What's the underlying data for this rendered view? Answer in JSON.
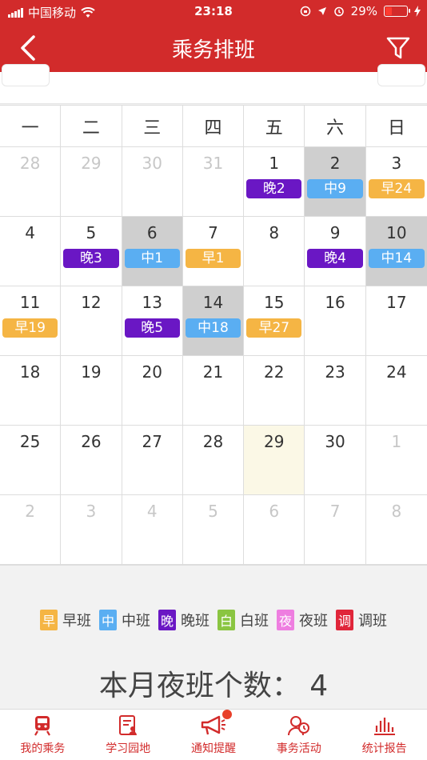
{
  "status_bar": {
    "carrier": "中国移动",
    "time": "23:18",
    "battery": "29%",
    "battery_level": 0.29
  },
  "header": {
    "title": "乘务排班"
  },
  "calendar": {
    "week_labels": [
      "一",
      "二",
      "三",
      "四",
      "五",
      "六",
      "日"
    ],
    "days": [
      {
        "num": "28",
        "other": true
      },
      {
        "num": "29",
        "other": true
      },
      {
        "num": "30",
        "other": true
      },
      {
        "num": "31",
        "other": true
      },
      {
        "num": "1",
        "badge": "晚2",
        "type": "night"
      },
      {
        "num": "2",
        "badge": "中9",
        "type": "mid",
        "gray": true
      },
      {
        "num": "3",
        "badge": "早24",
        "type": "early"
      },
      {
        "num": "4"
      },
      {
        "num": "5",
        "badge": "晚3",
        "type": "night"
      },
      {
        "num": "6",
        "badge": "中1",
        "type": "mid",
        "gray": true
      },
      {
        "num": "7",
        "badge": "早1",
        "type": "early"
      },
      {
        "num": "8"
      },
      {
        "num": "9",
        "badge": "晚4",
        "type": "night"
      },
      {
        "num": "10",
        "badge": "中14",
        "type": "mid",
        "gray": true
      },
      {
        "num": "11",
        "badge": "早19",
        "type": "early"
      },
      {
        "num": "12"
      },
      {
        "num": "13",
        "badge": "晚5",
        "type": "night"
      },
      {
        "num": "14",
        "badge": "中18",
        "type": "mid",
        "gray": true
      },
      {
        "num": "15",
        "badge": "早27",
        "type": "early"
      },
      {
        "num": "16"
      },
      {
        "num": "17"
      },
      {
        "num": "18"
      },
      {
        "num": "19"
      },
      {
        "num": "20"
      },
      {
        "num": "21"
      },
      {
        "num": "22"
      },
      {
        "num": "23"
      },
      {
        "num": "24"
      },
      {
        "num": "25"
      },
      {
        "num": "26"
      },
      {
        "num": "27"
      },
      {
        "num": "28"
      },
      {
        "num": "29",
        "today": true
      },
      {
        "num": "30"
      },
      {
        "num": "1",
        "other": true
      },
      {
        "num": "2",
        "other": true
      },
      {
        "num": "3",
        "other": true
      },
      {
        "num": "4",
        "other": true
      },
      {
        "num": "5",
        "other": true
      },
      {
        "num": "6",
        "other": true
      },
      {
        "num": "7",
        "other": true
      },
      {
        "num": "8",
        "other": true
      }
    ]
  },
  "legend": [
    {
      "char": "早",
      "label": "早班",
      "color": "#f5b544"
    },
    {
      "char": "中",
      "label": "中班",
      "color": "#5aaef2"
    },
    {
      "char": "晚",
      "label": "晚班",
      "color": "#6a17c4"
    },
    {
      "char": "白",
      "label": "白班",
      "color": "#8ac541"
    },
    {
      "char": "夜",
      "label": "夜班",
      "color": "#ee7ee0"
    },
    {
      "char": "调",
      "label": "调班",
      "color": "#e0263a"
    }
  ],
  "colors": {
    "early": "#f5b544",
    "mid": "#5aaef2",
    "night": "#6a17c4",
    "brand": "#d22b2b"
  },
  "summary": {
    "text": "本月夜班个数： 4"
  },
  "tabbar": [
    {
      "label": "我的乘务",
      "icon": "train-icon"
    },
    {
      "label": "学习园地",
      "icon": "study-icon"
    },
    {
      "label": "通知提醒",
      "icon": "megaphone-icon"
    },
    {
      "label": "事务活动",
      "icon": "people-icon"
    },
    {
      "label": "统计报告",
      "icon": "stats-icon"
    }
  ]
}
